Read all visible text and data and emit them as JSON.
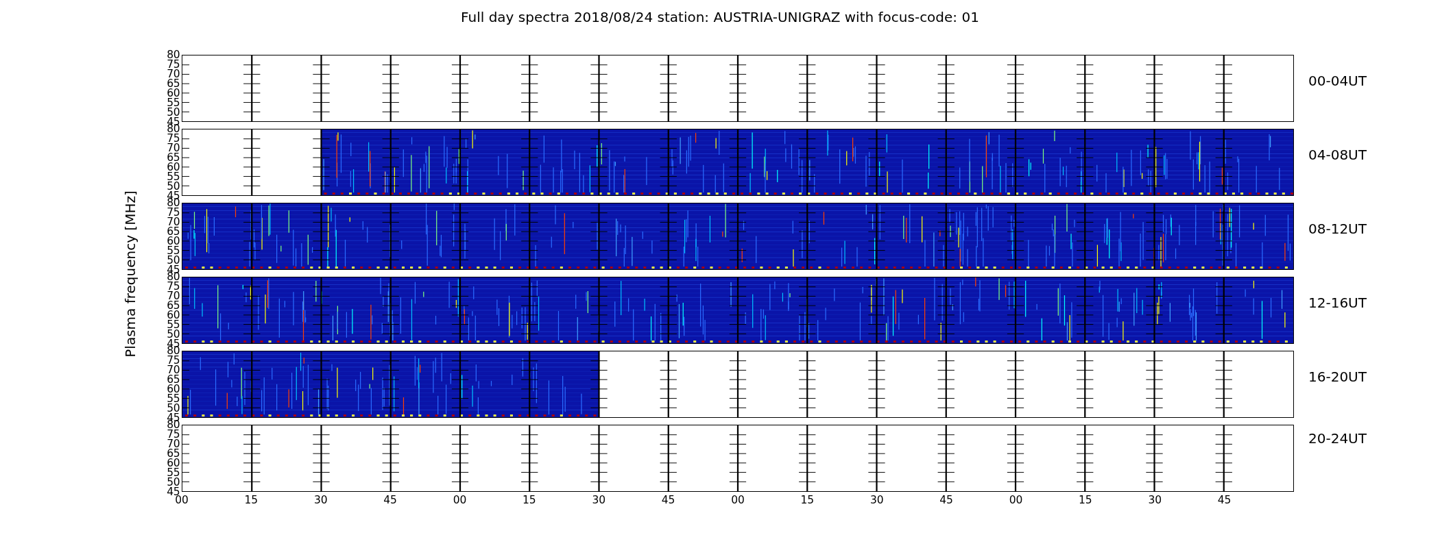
{
  "title": "Full day spectra 2018/08/24 station: AUSTRIA-UNIGRAZ with focus-code: 01",
  "ylabel": "Plasma frequency [MHz]",
  "panels": [
    {
      "label": "00-04UT",
      "kind": "empty",
      "yticks": [
        "80",
        "75",
        "70",
        "65",
        "60",
        "55",
        "50",
        "45"
      ]
    },
    {
      "label": "04-08UT",
      "kind": "from_right",
      "level": 0.875,
      "yticks": [
        "80",
        "75",
        "70",
        "65",
        "60",
        "55",
        "50",
        "45"
      ]
    },
    {
      "label": "08-12UT",
      "kind": "from_left",
      "level": 1,
      "yticks": [
        "80",
        "75",
        "70",
        "65",
        "60",
        "55",
        "50",
        "45"
      ]
    },
    {
      "label": "12-16UT",
      "kind": "from_left",
      "level": 1,
      "yticks": [
        "80",
        "75",
        "70",
        "65",
        "60",
        "55",
        "50",
        "45"
      ]
    },
    {
      "label": "16-20UT",
      "kind": "from_left",
      "level": 0.375,
      "yticks": [
        "80",
        "75",
        "70",
        "65",
        "60",
        "55",
        "50",
        "45"
      ]
    },
    {
      "label": "20-24UT",
      "kind": "empty",
      "yticks": [
        "80",
        "75",
        "70",
        "65",
        "60",
        "55",
        "50",
        "45"
      ]
    }
  ],
  "xticks": [
    "00",
    "15",
    "30",
    "45",
    "00",
    "15",
    "30",
    "45",
    "00",
    "15",
    "30",
    "45",
    "00",
    "15",
    "30",
    "45"
  ]
}
